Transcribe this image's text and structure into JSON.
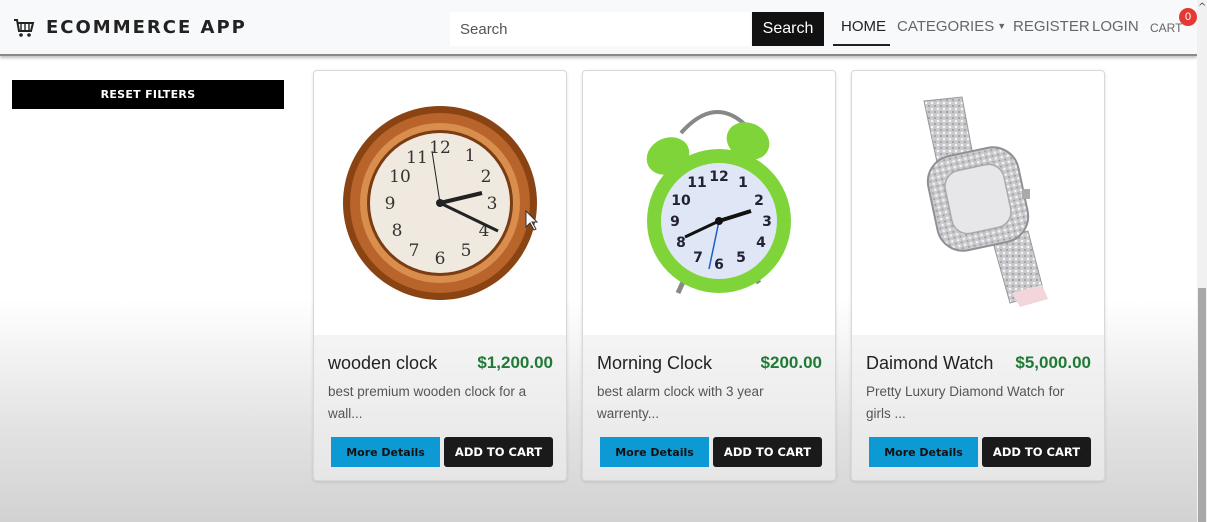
{
  "navbar": {
    "brand": "ECOMMERCE APP",
    "brand_icon": "shopping-cart-icon",
    "search_placeholder": "Search",
    "search_button": "Search",
    "links": {
      "home": "HOME",
      "categories": "CATEGORIES",
      "register": "REGISTER",
      "login": "LOGIN",
      "cart": "CART"
    },
    "cart_count": "0"
  },
  "sidebar": {
    "reset_filters": "RESET FILTERS"
  },
  "products": [
    {
      "name": "wooden clock",
      "price": "$1,200.00",
      "description": "best premium wooden clock for a wall...",
      "image": "wooden-wall-clock",
      "details_label": "More Details",
      "cart_label": "ADD TO CART"
    },
    {
      "name": "Morning Clock",
      "price": "$200.00",
      "description": "best alarm clock with 3 year warrenty...",
      "image": "green-alarm-clock",
      "details_label": "More Details",
      "cart_label": "ADD TO CART"
    },
    {
      "name": "Daimond Watch",
      "price": "$5,000.00",
      "description": "Pretty Luxury Diamond Watch for girls ...",
      "image": "diamond-wrist-watch",
      "details_label": "More Details",
      "cart_label": "ADD TO CART"
    }
  ],
  "colors": {
    "accent_button": "#0d9ad4",
    "price": "#1f7a36",
    "badge": "#e53935"
  }
}
